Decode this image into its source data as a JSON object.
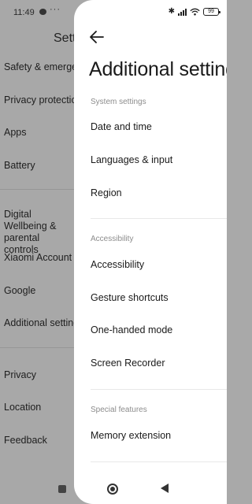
{
  "status_bar": {
    "time": "11:49",
    "more": "···",
    "battery": "99"
  },
  "background": {
    "title": "Settings",
    "items": [
      {
        "label": "Safety & emergency"
      },
      {
        "label": "Privacy protection"
      },
      {
        "label": "Apps"
      },
      {
        "label": "Battery"
      },
      {
        "label": "Digital Wellbeing & parental controls"
      },
      {
        "label": "Xiaomi Account"
      },
      {
        "label": "Google"
      },
      {
        "label": "Additional settings"
      },
      {
        "label": "Privacy"
      },
      {
        "label": "Location"
      },
      {
        "label": "Feedback"
      }
    ]
  },
  "sheet": {
    "title": "Additional settings",
    "sections": [
      {
        "header": "System settings",
        "items": [
          {
            "label": "Date and time"
          },
          {
            "label": "Languages & input"
          },
          {
            "label": "Region"
          }
        ]
      },
      {
        "header": "Accessibility",
        "items": [
          {
            "label": "Accessibility"
          },
          {
            "label": "Gesture shortcuts"
          },
          {
            "label": "One-handed mode"
          },
          {
            "label": "Screen Recorder"
          }
        ]
      },
      {
        "header": "Special features",
        "items": [
          {
            "label": "Memory extension"
          }
        ]
      }
    ]
  },
  "icons": {
    "back": "arrow-left-icon",
    "bluetooth": "bluetooth-icon",
    "signal": "signal-icon",
    "wifi": "wifi-icon",
    "battery": "battery-icon",
    "home": "home-circle-icon",
    "recents": "recents-square-icon",
    "nav_back": "triangle-back-icon"
  },
  "colors": {
    "sheet_bg": "#ffffff",
    "dim_bg": "#a8a8a8",
    "section_header": "#8c8c8c"
  }
}
